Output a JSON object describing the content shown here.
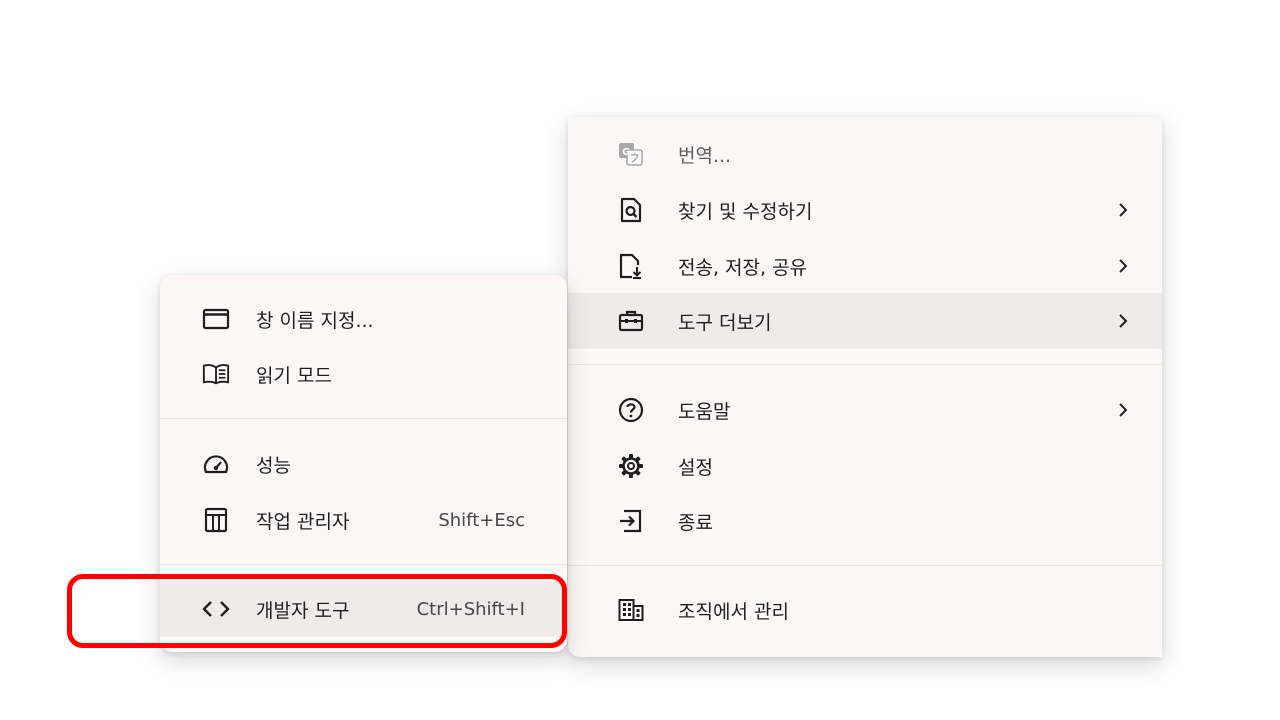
{
  "main_menu": {
    "items": [
      {
        "label": "번역...",
        "icon": "translate-icon"
      },
      {
        "label": "찾기 및 수정하기",
        "icon": "find-icon"
      },
      {
        "label": "전송, 저장, 공유",
        "icon": "save-share-icon"
      },
      {
        "label": "도구 더보기",
        "icon": "toolbox-icon"
      },
      {
        "label": "도움말",
        "icon": "help-icon"
      },
      {
        "label": "설정",
        "icon": "gear-icon"
      },
      {
        "label": "종료",
        "icon": "exit-icon"
      },
      {
        "label": "조직에서 관리",
        "icon": "building-icon"
      }
    ]
  },
  "sub_menu": {
    "items": [
      {
        "label": "창 이름 지정...",
        "icon": "window-icon"
      },
      {
        "label": "읽기 모드",
        "icon": "book-icon"
      },
      {
        "label": "성능",
        "icon": "speedometer-icon"
      },
      {
        "label": "작업 관리자",
        "shortcut": "Shift+Esc",
        "icon": "task-manager-icon"
      },
      {
        "label": "개발자 도구",
        "shortcut": "Ctrl+Shift+I",
        "icon": "code-icon"
      }
    ]
  },
  "colors": {
    "menu_bg": "#fdf8f8",
    "hover_bg": "#efebeb",
    "highlight": "#ff0000",
    "separator": "#f3e1da"
  }
}
